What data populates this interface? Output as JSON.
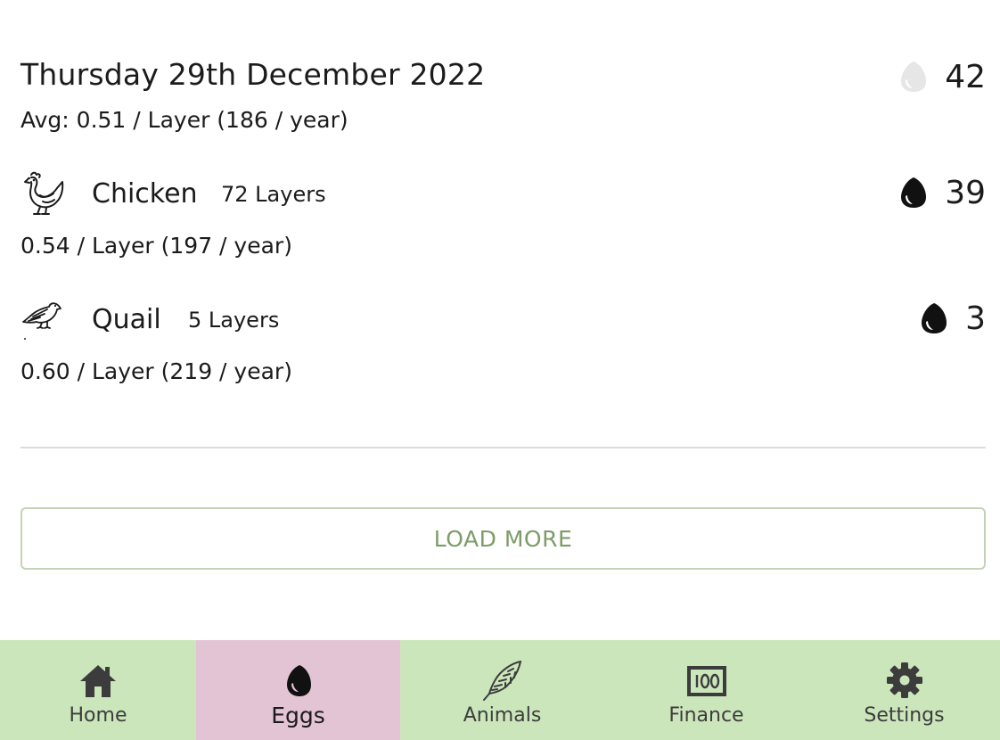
{
  "day": {
    "title": "Thursday 29th December 2022",
    "total": "42",
    "avg": "Avg: 0.51 / Layer (186 / year)"
  },
  "species": [
    {
      "name": "Chicken",
      "layers": "72 Layers",
      "count": "39",
      "rate": "0.54 / Layer (197 / year)",
      "icon": "chicken-icon"
    },
    {
      "name": "Quail",
      "layers": "5 Layers",
      "count": "3",
      "rate": "0.60 / Layer (219 / year)",
      "icon": "quail-icon"
    }
  ],
  "load_more_label": "LOAD MORE",
  "nav": {
    "items": [
      {
        "label": "Home",
        "icon": "home-icon"
      },
      {
        "label": "Eggs",
        "icon": "egg-icon",
        "active": true
      },
      {
        "label": "Animals",
        "icon": "feather-icon"
      },
      {
        "label": "Finance",
        "icon": "money-icon"
      },
      {
        "label": "Settings",
        "icon": "gear-icon"
      }
    ]
  },
  "colors": {
    "nav_background": "#cce6bc",
    "nav_active": "#e3c4d4",
    "accent_green": "#7d9c69",
    "egg_light": "#e4e4e4",
    "egg_dark": "#111111"
  }
}
